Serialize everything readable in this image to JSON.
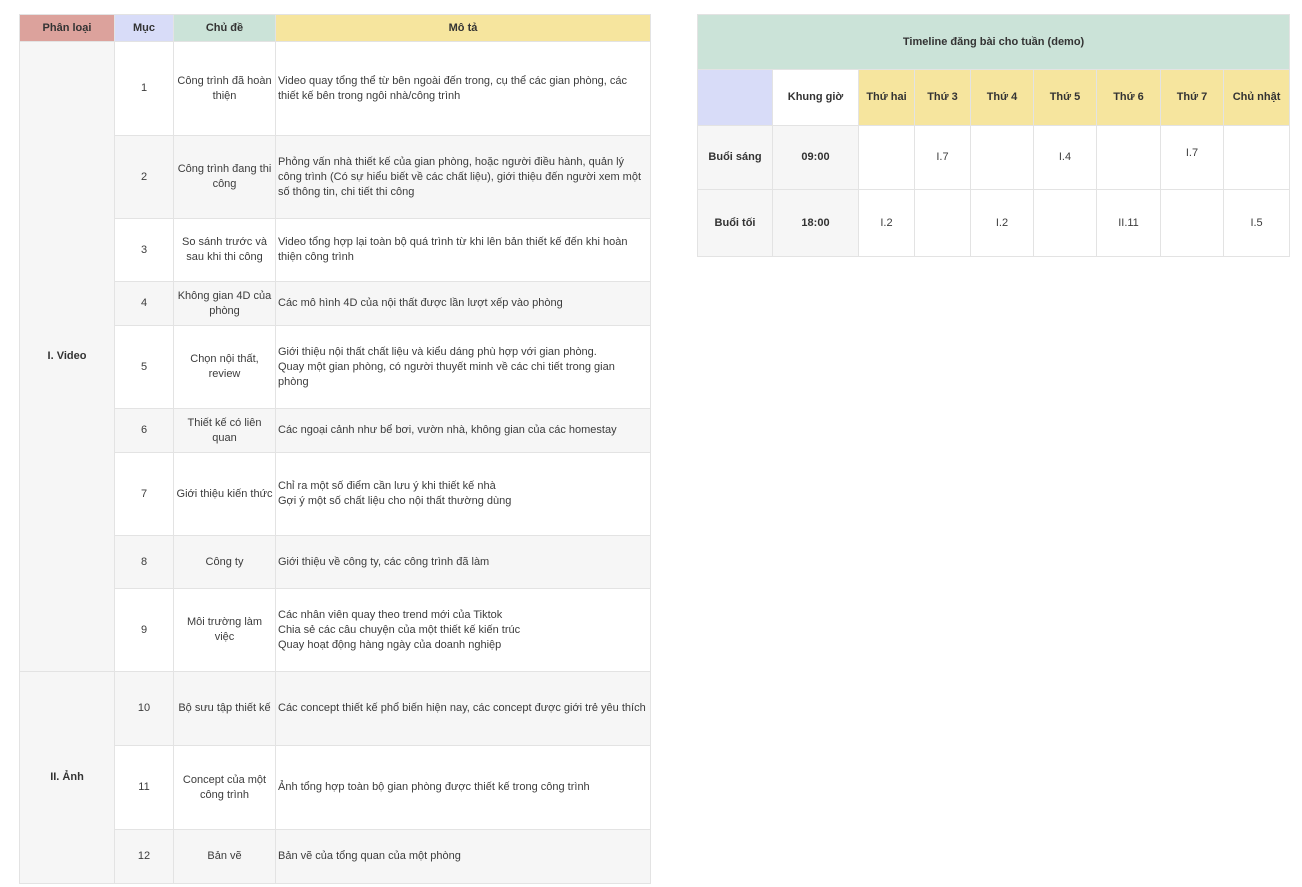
{
  "content_table": {
    "headers": {
      "category": "Phân loại",
      "item": "Mục",
      "topic": "Chủ đề",
      "description": "Mô tả"
    },
    "categories": [
      {
        "label": "I. Video"
      },
      {
        "label": "II. Ảnh"
      }
    ],
    "rows": [
      {
        "num": "1",
        "topic": "Công trình đã hoàn thiện",
        "description": "Video quay tổng thể từ bên ngoài đến trong, cụ thể các gian phòng, các thiết kế bên trong ngôi nhà/công trình"
      },
      {
        "num": "2",
        "topic": "Công trình đang thi công",
        "description": "Phỏng vấn nhà thiết kế của gian phòng, hoặc người điều hành, quản lý công trình (Có sự hiểu biết về các chất liệu), giới thiệu đến người xem một số thông tin, chi tiết thi công"
      },
      {
        "num": "3",
        "topic": "So sánh trước và sau khi thi công",
        "description": "Video tổng hợp lại toàn bộ quá trình từ khi lên bản thiết kế đến khi hoàn thiện công trình"
      },
      {
        "num": "4",
        "topic": "Không gian 4D của phòng",
        "description": "Các mô hình 4D của nội thất được lần lượt xếp vào phòng"
      },
      {
        "num": "5",
        "topic": "Chọn nội thất, review",
        "description": "Giới thiệu nội thất chất liệu và kiểu dáng phù hợp với gian phòng.\nQuay một gian phòng, có người thuyết minh về các chi tiết trong gian phòng"
      },
      {
        "num": "6",
        "topic": "Thiết kế có liên quan",
        "description": "Các ngoại cảnh như bể bơi, vườn nhà, không gian của các homestay"
      },
      {
        "num": "7",
        "topic": "Giới thiệu kiến thức",
        "description": "Chỉ ra một số điểm cần lưu ý khi thiết kế nhà\nGợi ý một số chất liệu cho nội thất thường dùng"
      },
      {
        "num": "8",
        "topic": "Công ty",
        "description": "Giới thiệu về công ty, các công trình đã làm"
      },
      {
        "num": "9",
        "topic": "Môi trường làm việc",
        "description": "Các nhân viên quay theo trend mới của Tiktok\nChia sẻ các câu chuyện của một thiết kế kiến trúc\nQuay hoạt động hàng ngày của doanh nghiệp"
      },
      {
        "num": "10",
        "topic": "Bộ sưu tập thiết kế",
        "description": "Các concept thiết kế phổ biến hiện nay, các concept được giới trẻ yêu thích"
      },
      {
        "num": "11",
        "topic": "Concept của một công trình",
        "description": "Ảnh tổng hợp toàn bộ gian phòng được thiết kế trong công trình"
      },
      {
        "num": "12",
        "topic": "Bản vẽ",
        "description": "Bản vẽ của tổng quan của một phòng"
      }
    ]
  },
  "timeline": {
    "title": "Timeline đăng bài cho tuần (demo)",
    "slot_header": "Khung giờ",
    "days": [
      "Thứ hai",
      "Thứ 3",
      "Thứ 4",
      "Thứ 5",
      "Thứ 6",
      "Thứ 7",
      "Chủ nhật"
    ],
    "rows": [
      {
        "label": "Buổi sáng",
        "time": "09:00",
        "cells": [
          "",
          "I.7",
          "",
          "I.4",
          "",
          "I.7",
          ""
        ]
      },
      {
        "label": "Buổi tối",
        "time": "18:00",
        "cells": [
          "I.2",
          "",
          "I.2",
          "",
          "II.11",
          "",
          "I.5"
        ]
      }
    ]
  },
  "colors": {
    "category_header": "#dca29c",
    "item_header": "#d8dcf8",
    "topic_header": "#cbe3d8",
    "description_header": "#f6e59e"
  }
}
